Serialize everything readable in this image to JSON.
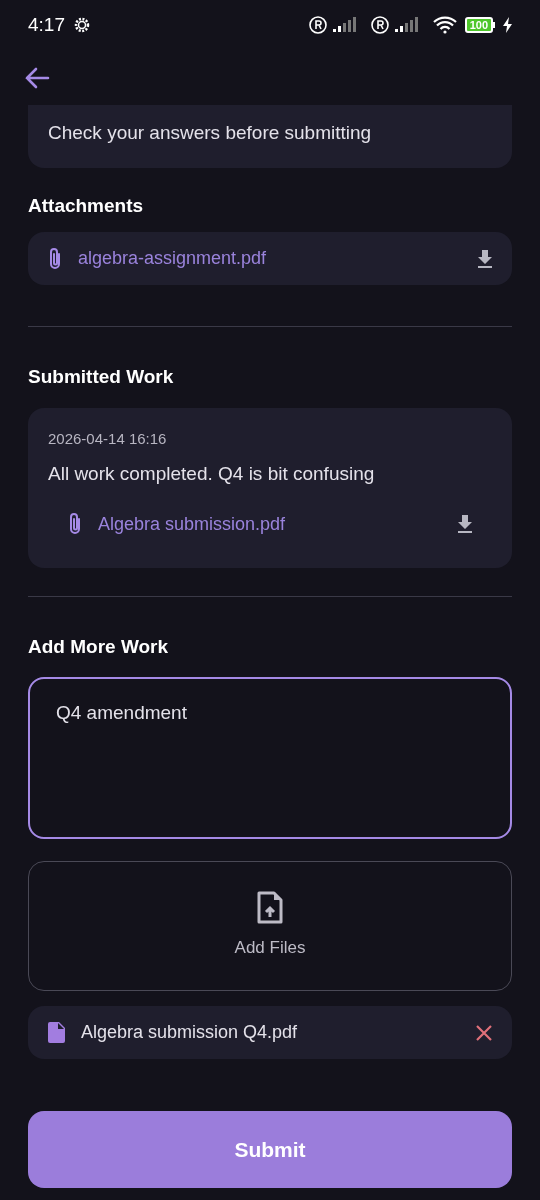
{
  "status_bar": {
    "time": "4:17",
    "battery": "100"
  },
  "instructions": {
    "lines": [
      "Check your answers before submitting"
    ]
  },
  "attachments": {
    "title": "Attachments",
    "files": [
      {
        "name": "algebra-assignment.pdf"
      }
    ]
  },
  "submitted_work": {
    "title": "Submitted Work",
    "entries": [
      {
        "timestamp": "2026-04-14 16:16",
        "comment": "All work completed. Q4 is bit confusing",
        "files": [
          {
            "name": "Algebra submission.pdf"
          }
        ]
      }
    ]
  },
  "add_more_work": {
    "title": "Add More Work",
    "text_value": "Q4 amendment",
    "focused": true,
    "add_files_label": "Add Files",
    "selected_files": [
      {
        "name": "Algebra submission Q4.pdf"
      }
    ]
  },
  "submit_button": {
    "label": "Submit"
  }
}
